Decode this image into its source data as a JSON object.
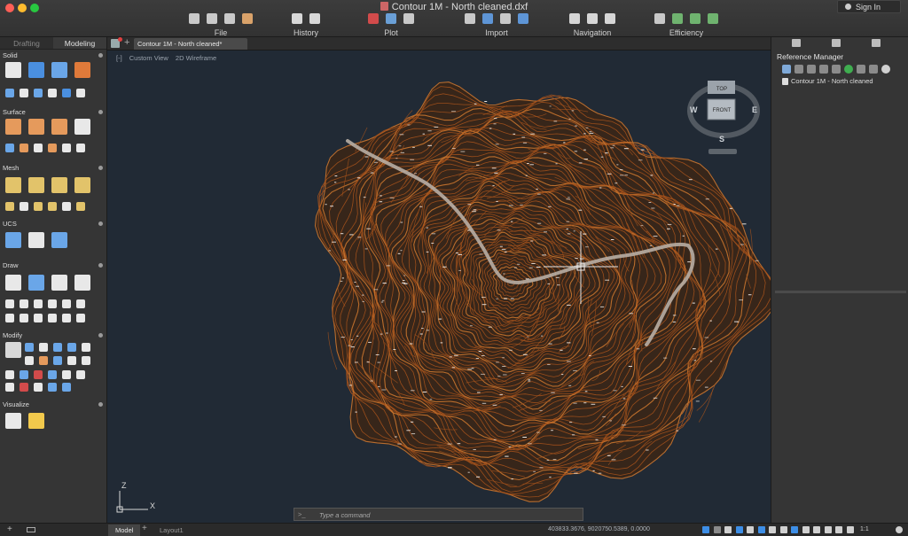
{
  "window": {
    "title": "Contour 1M - North cleaned.dxf",
    "traffic_colors": [
      "#ff5f57",
      "#febc2e",
      "#28c840"
    ],
    "sign_in": "Sign In"
  },
  "toolbar": {
    "groups": [
      {
        "label": "File",
        "icons": [
          "new-icon",
          "open-icon",
          "save-icon",
          "save-as-icon"
        ],
        "colors": [
          "#c9c9c9",
          "#c9c9c9",
          "#c9c9c9",
          "#d9a26a"
        ]
      },
      {
        "label": "History",
        "icons": [
          "undo-icon",
          "redo-icon"
        ],
        "colors": [
          "#d8d8d8",
          "#d8d8d8"
        ]
      },
      {
        "label": "Plot",
        "icons": [
          "print-icon",
          "publish-icon",
          "pdf-icon"
        ],
        "colors": [
          "#d24b4b",
          "#6a9fd6",
          "#c8c8c8"
        ]
      },
      {
        "label": "Import",
        "icons": [
          "import-icon",
          "export-icon",
          "attach-icon",
          "dwg-icon"
        ],
        "colors": [
          "#c8c8c8",
          "#5e95d6",
          "#c8c8c8",
          "#5e95d6"
        ]
      },
      {
        "label": "Navigation",
        "icons": [
          "zoom-icon",
          "pan-icon",
          "orbit-icon"
        ],
        "colors": [
          "#d6d6d6",
          "#d6d6d6",
          "#d6d6d6"
        ]
      },
      {
        "label": "Efficiency",
        "icons": [
          "match-properties-icon",
          "quick-select-icon",
          "layer-tools-icon",
          "group-icon"
        ],
        "colors": [
          "#c8c8c8",
          "#6fb36f",
          "#6fb36f",
          "#6fb36f"
        ]
      }
    ]
  },
  "left_panel": {
    "tabs": [
      {
        "label": "Drafting",
        "active": false
      },
      {
        "label": "Modeling",
        "active": true
      }
    ],
    "sections": [
      {
        "label": "Solid"
      },
      {
        "label": "Surface"
      },
      {
        "label": "Mesh"
      },
      {
        "label": "UCS"
      },
      {
        "label": "Draw"
      },
      {
        "label": "Modify"
      },
      {
        "label": "Visualize"
      }
    ]
  },
  "document": {
    "tab_label": "Contour 1M - North cleaned*",
    "view_label": "Custom View",
    "visual_style": "2D Wireframe"
  },
  "viewcube": {
    "top": "TOP",
    "front": "FRONT",
    "west": "W",
    "east": "E",
    "south": "S"
  },
  "ucs": {
    "x": "X",
    "z": "Z"
  },
  "command_line": {
    "prompt": ">_",
    "placeholder": "Type a command"
  },
  "right_panel": {
    "title": "Reference Manager",
    "item": "Contour 1M - North cleaned"
  },
  "status_bar": {
    "model_tab": "Model",
    "layout_tab": "Layout1",
    "coordinates": "403833.3676, 9020750.5389, 0.0000",
    "annotation_scale": "1:1"
  },
  "colors": {
    "viewport_bg": "#212a35",
    "contour": "#a5521c",
    "contour_light": "#c8742e",
    "river": "#b8aea4",
    "accent_blue": "#3d8ee6"
  }
}
